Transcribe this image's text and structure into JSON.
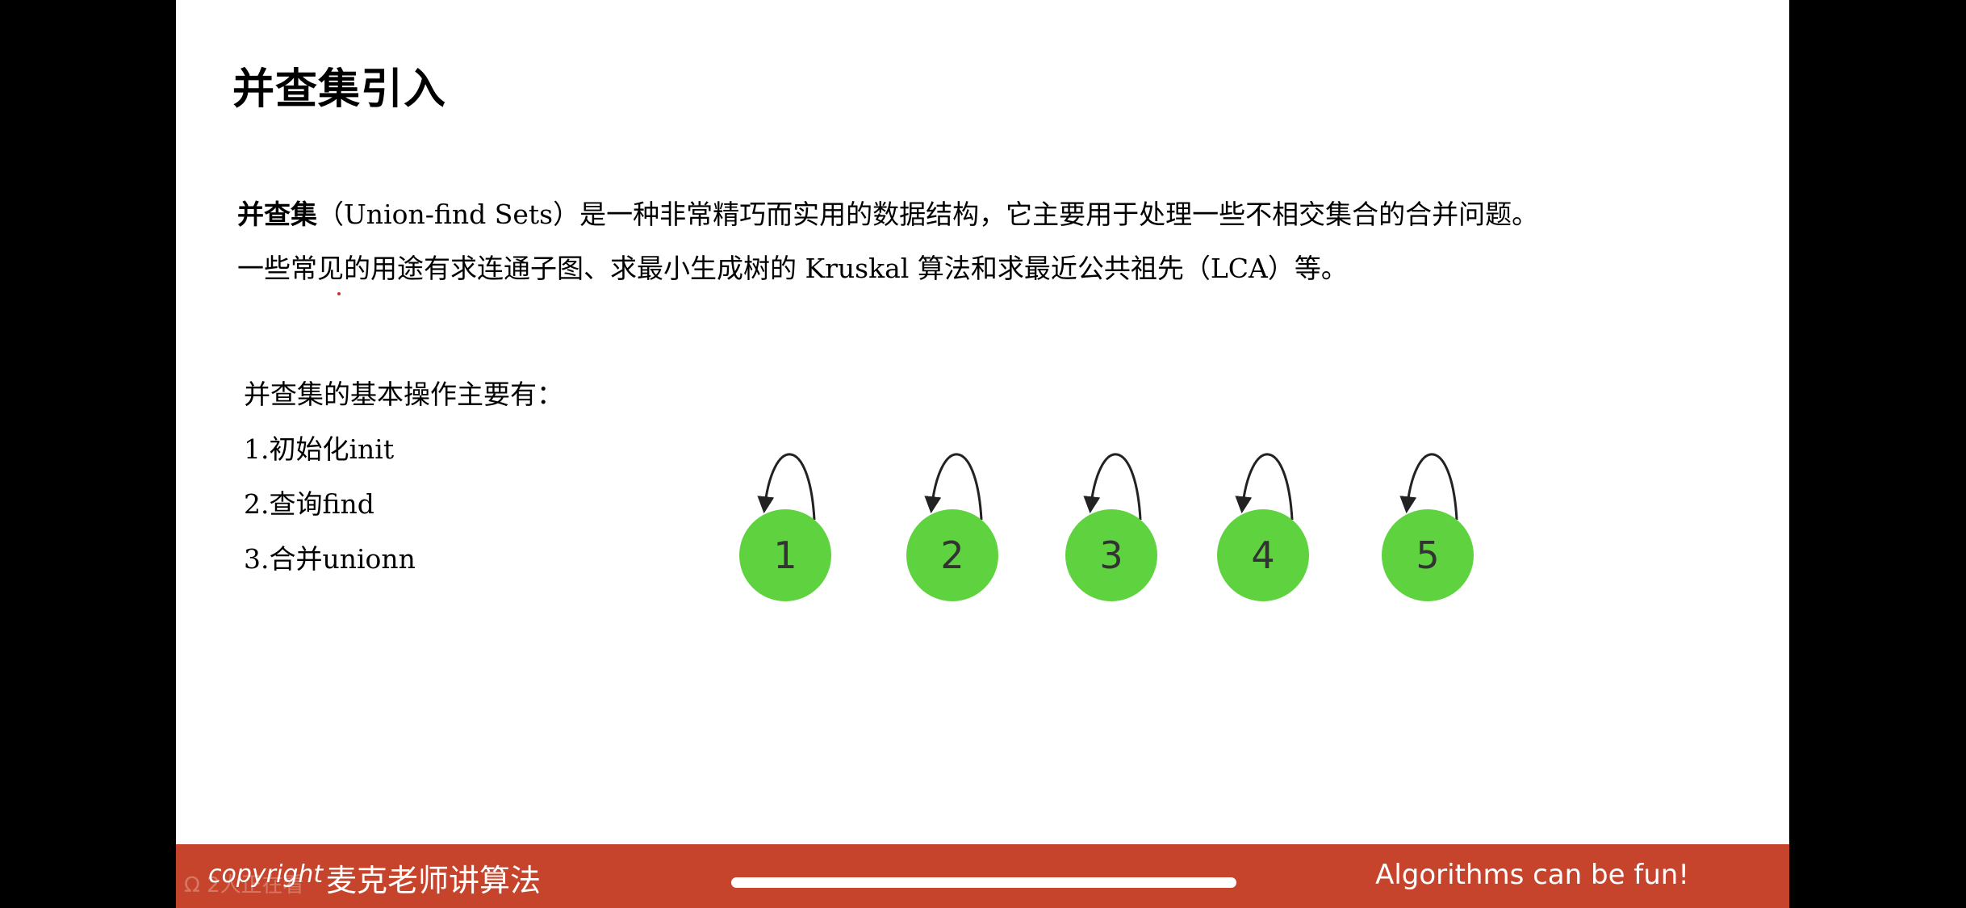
{
  "slide": {
    "title": "并查集引入",
    "intro": {
      "term": "并查集",
      "line1_rest": "（Union-find Sets）是一种非常精巧而实用的数据结构，它主要用于处理一些不相交集合的合并问题。",
      "line2": "一些常见的用途有求连通子图、求最小生成树的 Kruskal 算法和求最近公共祖先（LCA）等。"
    },
    "operations": {
      "heading": "并查集的基本操作主要有：",
      "items": [
        "1.初始化init",
        "2.查询find",
        "3.合并unionn"
      ]
    },
    "diagram": {
      "nodes": [
        "1",
        "2",
        "3",
        "4",
        "5"
      ],
      "node_color": "#5ed33f",
      "self_loop": true
    }
  },
  "footer": {
    "faint_text": "Ω 2人正在看",
    "copyright": "copyright",
    "brand": "麦克老师讲算法",
    "tagline": "Algorithms can be fun!",
    "color": "#c7442c"
  }
}
